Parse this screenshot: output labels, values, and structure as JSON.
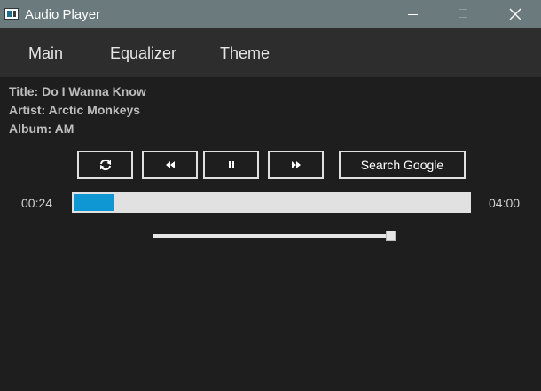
{
  "window": {
    "title": "Audio Player",
    "icon": "audio-player-app-icon",
    "controls": [
      "minimize-icon",
      "maximize-icon",
      "close-icon"
    ]
  },
  "menu": {
    "items": [
      {
        "label": "Main"
      },
      {
        "label": "Equalizer"
      },
      {
        "label": "Theme"
      }
    ]
  },
  "track": {
    "title_line": "Title: Do I Wanna Know",
    "artist_line": "Artist: Arctic Monkeys",
    "album_line": "Album: AM"
  },
  "controls": {
    "repeat_icon": "repeat-icon",
    "previous_icon": "rewind-icon",
    "pause_icon": "pause-icon",
    "next_icon": "fast-forward-icon",
    "search_label": "Search Google"
  },
  "playback": {
    "current_time": "00:24",
    "duration": "04:00",
    "progress_fraction": 0.1
  },
  "volume": {
    "level_fraction": 1.0
  },
  "colors": {
    "background": "#1e1e1e",
    "titlebar": "#6b7b7d",
    "menubar": "#2d2d2d",
    "accent": "#0e97d2",
    "track": "#e1e1e1"
  }
}
